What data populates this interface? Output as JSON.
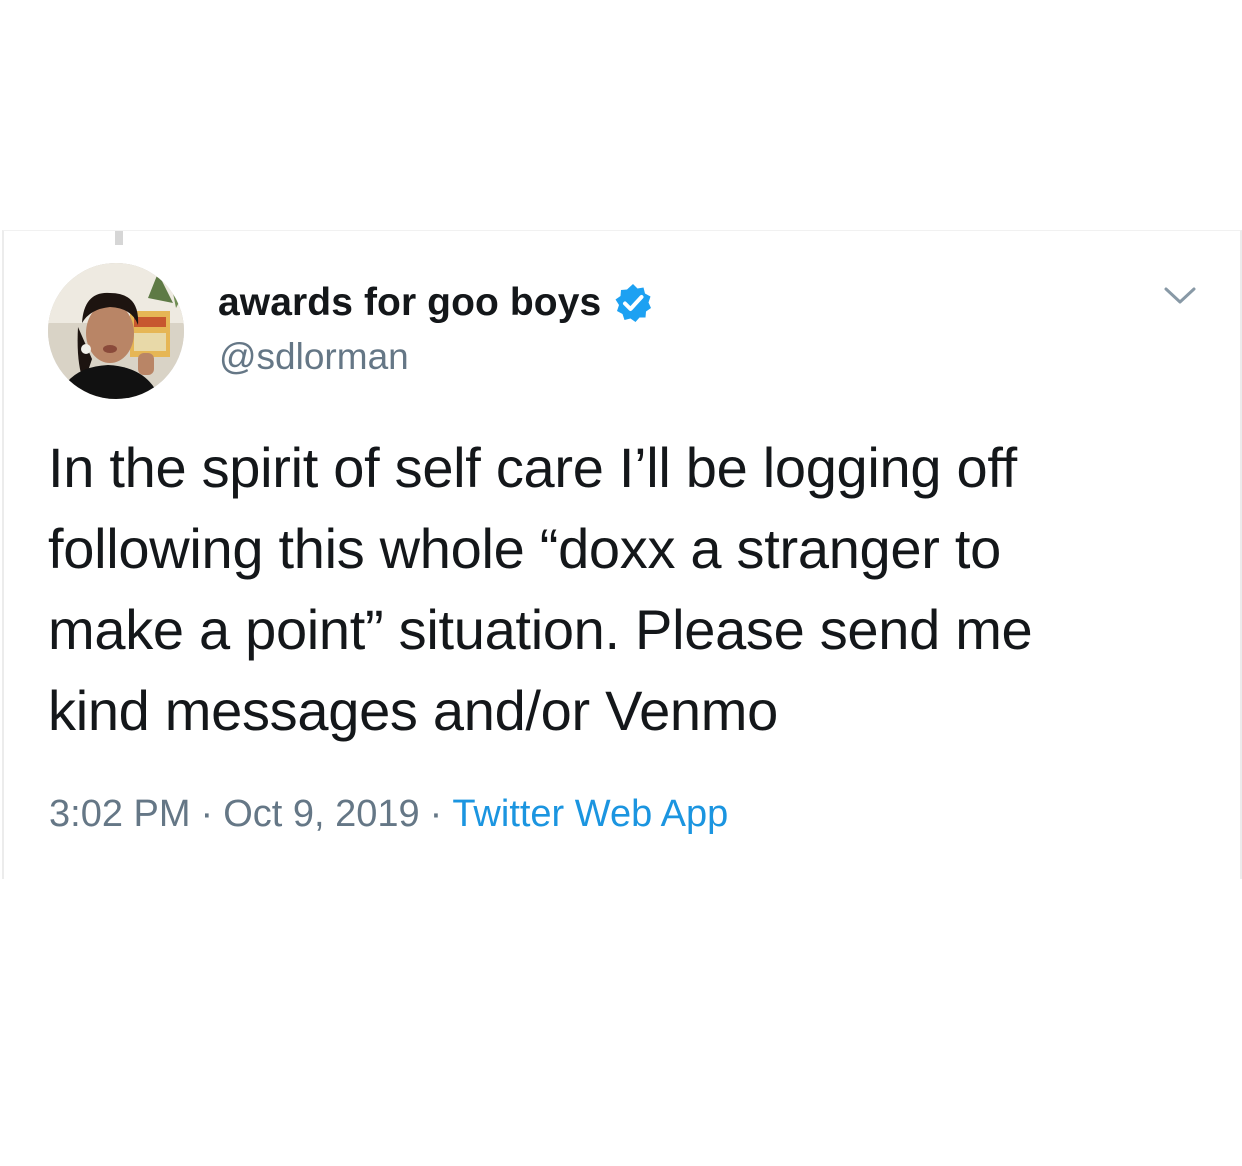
{
  "tweet": {
    "display_name": "awards for goo boys",
    "handle": "@sdlorman",
    "verified": true,
    "text_lines": [
      "In the spirit of self care I’ll be logging off",
      "following this whole “doxx a stranger to",
      "make a point” situation. Please send me",
      "kind messages and/or Venmo"
    ],
    "time": "3:02 PM",
    "date": "Oct 9, 2019",
    "separator": "·",
    "source": "Twitter Web App"
  },
  "icons": {
    "verified": "verified-badge-icon",
    "menu": "chevron-down-icon"
  },
  "colors": {
    "name": "#14171a",
    "secondary": "#657786",
    "link": "#1b95e0",
    "verified": "#1da1f2"
  }
}
